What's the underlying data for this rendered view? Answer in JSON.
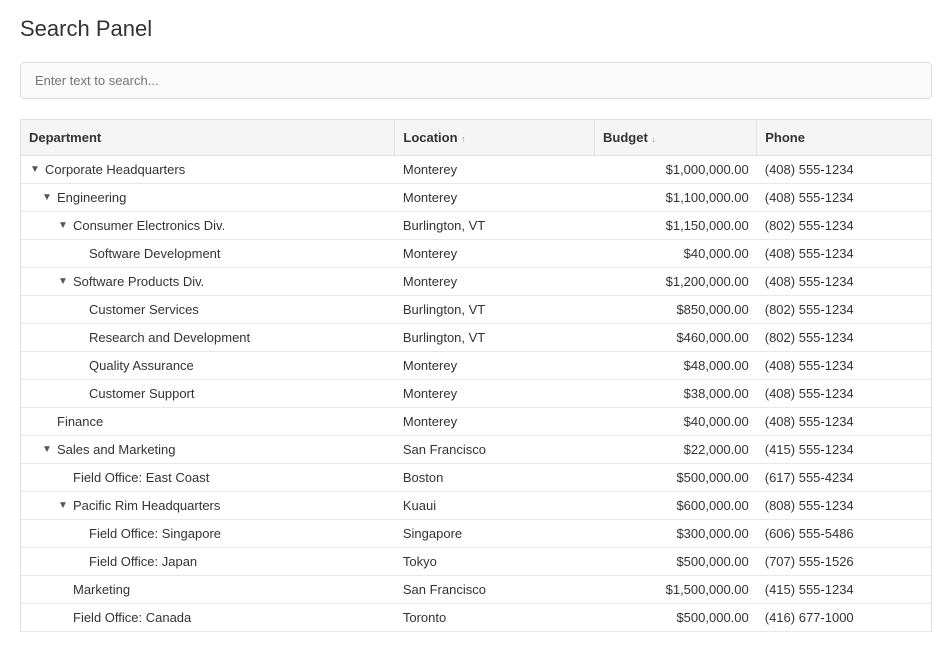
{
  "title": "Search Panel",
  "search": {
    "placeholder": "Enter text to search..."
  },
  "table": {
    "columns": [
      {
        "key": "department",
        "label": "Department",
        "sort": "none"
      },
      {
        "key": "location",
        "label": "Location",
        "sort": "asc"
      },
      {
        "key": "budget",
        "label": "Budget",
        "sort": "desc"
      },
      {
        "key": "phone",
        "label": "Phone",
        "sort": "none"
      }
    ],
    "rows": [
      {
        "id": 1,
        "depth": 0,
        "toggle": "▼",
        "name": "Corporate Headquarters",
        "location": "Monterey",
        "budget": "$1,000,000.00",
        "phone": "(408) 555-1234"
      },
      {
        "id": 2,
        "depth": 1,
        "toggle": "▼",
        "name": "Engineering",
        "location": "Monterey",
        "budget": "$1,100,000.00",
        "phone": "(408) 555-1234"
      },
      {
        "id": 3,
        "depth": 2,
        "toggle": "▼",
        "name": "Consumer Electronics Div.",
        "location": "Burlington, VT",
        "budget": "$1,150,000.00",
        "phone": "(802) 555-1234"
      },
      {
        "id": 4,
        "depth": 3,
        "toggle": "",
        "name": "Software Development",
        "location": "Monterey",
        "budget": "$40,000.00",
        "phone": "(408) 555-1234"
      },
      {
        "id": 5,
        "depth": 2,
        "toggle": "▼",
        "name": "Software Products Div.",
        "location": "Monterey",
        "budget": "$1,200,000.00",
        "phone": "(408) 555-1234"
      },
      {
        "id": 6,
        "depth": 3,
        "toggle": "",
        "name": "Customer Services",
        "location": "Burlington, VT",
        "budget": "$850,000.00",
        "phone": "(802) 555-1234"
      },
      {
        "id": 7,
        "depth": 3,
        "toggle": "",
        "name": "Research and Development",
        "location": "Burlington, VT",
        "budget": "$460,000.00",
        "phone": "(802) 555-1234"
      },
      {
        "id": 8,
        "depth": 3,
        "toggle": "",
        "name": "Quality Assurance",
        "location": "Monterey",
        "budget": "$48,000.00",
        "phone": "(408) 555-1234"
      },
      {
        "id": 9,
        "depth": 3,
        "toggle": "",
        "name": "Customer Support",
        "location": "Monterey",
        "budget": "$38,000.00",
        "phone": "(408) 555-1234"
      },
      {
        "id": 10,
        "depth": 1,
        "toggle": "",
        "name": "Finance",
        "location": "Monterey",
        "budget": "$40,000.00",
        "phone": "(408) 555-1234"
      },
      {
        "id": 11,
        "depth": 1,
        "toggle": "▼",
        "name": "Sales and Marketing",
        "location": "San Francisco",
        "budget": "$22,000.00",
        "phone": "(415) 555-1234"
      },
      {
        "id": 12,
        "depth": 2,
        "toggle": "",
        "name": "Field Office: East Coast",
        "location": "Boston",
        "budget": "$500,000.00",
        "phone": "(617) 555-4234"
      },
      {
        "id": 13,
        "depth": 2,
        "toggle": "▼",
        "name": "Pacific Rim Headquarters",
        "location": "Kuaui",
        "budget": "$600,000.00",
        "phone": "(808) 555-1234"
      },
      {
        "id": 14,
        "depth": 3,
        "toggle": "",
        "name": "Field Office: Singapore",
        "location": "Singapore",
        "budget": "$300,000.00",
        "phone": "(606) 555-5486"
      },
      {
        "id": 15,
        "depth": 3,
        "toggle": "",
        "name": "Field Office: Japan",
        "location": "Tokyo",
        "budget": "$500,000.00",
        "phone": "(707) 555-1526"
      },
      {
        "id": 16,
        "depth": 2,
        "toggle": "",
        "name": "Marketing",
        "location": "San Francisco",
        "budget": "$1,500,000.00",
        "phone": "(415) 555-1234"
      },
      {
        "id": 17,
        "depth": 2,
        "toggle": "",
        "name": "Field Office: Canada",
        "location": "Toronto",
        "budget": "$500,000.00",
        "phone": "(416) 677-1000"
      }
    ]
  }
}
